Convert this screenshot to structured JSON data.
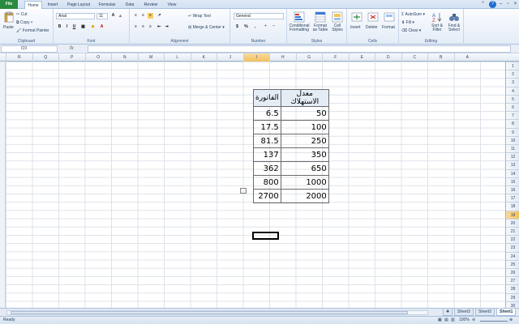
{
  "tabs": {
    "file": "File",
    "items": [
      "Home",
      "Insert",
      "Page Layout",
      "Formulas",
      "Data",
      "Review",
      "View"
    ],
    "active": "Home"
  },
  "ribbon": {
    "clipboard": {
      "label": "Clipboard",
      "paste": "Paste",
      "cut": "Cut",
      "copy": "Copy",
      "format_painter": "Format Painter"
    },
    "font": {
      "label": "Font",
      "name": "Arial",
      "size": "11",
      "bold": "B",
      "italic": "I",
      "underline": "U"
    },
    "alignment": {
      "label": "Alignment",
      "wrap": "Wrap Text",
      "merge": "Merge & Center"
    },
    "number": {
      "label": "Number",
      "format": "General",
      "currency": "$",
      "percent": "%",
      "comma": ","
    },
    "styles": {
      "label": "Styles",
      "conditional": "Conditional Formatting",
      "table": "Format as Table",
      "cell_styles": "Cell Styles"
    },
    "cells": {
      "label": "Cells",
      "insert": "Insert",
      "delete": "Delete",
      "format": "Format"
    },
    "editing": {
      "label": "Editing",
      "autosum": "AutoSum",
      "fill": "Fill",
      "clear": "Clear",
      "sort": "Sort & Filter",
      "find": "Find & Select"
    }
  },
  "formula_bar": {
    "name_box": "I19",
    "fx": "fx",
    "content": ""
  },
  "columns": [
    "R",
    "Q",
    "P",
    "O",
    "N",
    "M",
    "L",
    "K",
    "J",
    "I",
    "H",
    "G",
    "F",
    "E",
    "D",
    "C",
    "B",
    "A"
  ],
  "selected_column": "I",
  "rows": [
    "1",
    "2",
    "3",
    "4",
    "5",
    "6",
    "7",
    "8",
    "9",
    "10",
    "11",
    "12",
    "13",
    "14",
    "15",
    "16",
    "17",
    "18",
    "19",
    "20",
    "21",
    "22",
    "23",
    "24",
    "25",
    "26",
    "27",
    "28",
    "29",
    "30"
  ],
  "selected_row": "19",
  "table": {
    "header_h": "معدل الاستهلاك",
    "header_i": "الفاتورة",
    "rows": [
      {
        "h": "50",
        "i": "6.5"
      },
      {
        "h": "100",
        "i": "17.5"
      },
      {
        "h": "250",
        "i": "81.5"
      },
      {
        "h": "350",
        "i": "137"
      },
      {
        "h": "650",
        "i": "362"
      },
      {
        "h": "1000",
        "i": "800"
      },
      {
        "h": "2000",
        "i": "2700"
      }
    ]
  },
  "sheets": [
    "Sheet3",
    "Sheet2",
    "Sheet1"
  ],
  "active_sheet": "Sheet1",
  "status": {
    "ready": "Ready",
    "zoom": "100%"
  }
}
